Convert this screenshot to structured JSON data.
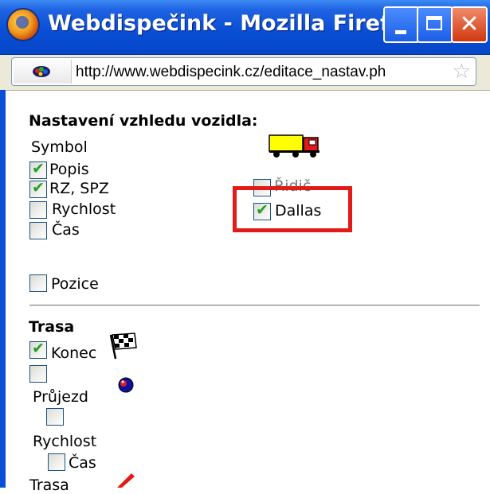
{
  "window": {
    "title": "Webdispečink - Mozilla Firefox",
    "close_glyph": "✕"
  },
  "address_bar": {
    "url": "http://www.webdispecink.cz/editace_nastav.ph"
  },
  "vehicle_section": {
    "title": "Nastavení vzhledu vozidla:",
    "symbol_label": "Symbol",
    "items": [
      {
        "label": "Popis",
        "checked": true
      },
      {
        "label": "RZ, SPZ",
        "checked": true
      },
      {
        "label": "Rychlost",
        "checked": false
      },
      {
        "label": "Čas",
        "checked": false
      }
    ],
    "right_items": [
      {
        "label": "Řidič",
        "checked": false
      },
      {
        "label": "Dallas",
        "checked": true
      }
    ],
    "position": {
      "label": "Pozice",
      "checked": false
    }
  },
  "route_section": {
    "title": "Trasa",
    "items": [
      {
        "label": "Konec",
        "checked": true
      },
      {
        "label": "Průjezd",
        "checked": false
      },
      {
        "label": "Rychlost",
        "checked": false
      },
      {
        "label": "Čas",
        "checked": false
      },
      {
        "label": "Trasa",
        "checked": false
      }
    ]
  },
  "colors": {
    "titlebar": "#0a4fd6",
    "highlight": "#e31a1a",
    "checkmark": "#21a121"
  },
  "icons": [
    "firefox-icon",
    "minimize-icon",
    "maximize-icon",
    "close-icon",
    "site-identity-icon",
    "bookmark-star-icon",
    "truck-icon",
    "checkered-flag-icon",
    "waypoint-icon",
    "route-marker-icon"
  ]
}
